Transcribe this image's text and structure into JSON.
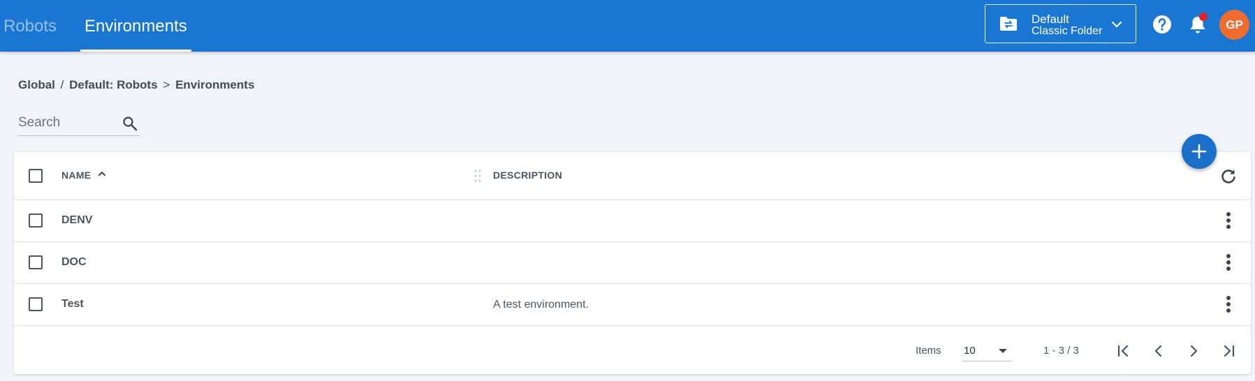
{
  "header": {
    "tabs": [
      {
        "label": "Robots",
        "active": false
      },
      {
        "label": "Environments",
        "active": true
      }
    ],
    "folder": {
      "name": "Default",
      "type": "Classic Folder",
      "icon": "folder-switch-icon"
    },
    "notification_dot_color": "#e0242f",
    "avatar_initials": "GP",
    "avatar_color": "#f06b30",
    "accent_color": "#1976d2"
  },
  "breadcrumb": {
    "root": "Global",
    "separator": "/",
    "folder": "Default: Robots",
    "arrow": ">",
    "current": "Environments"
  },
  "search": {
    "placeholder": "Search",
    "value": ""
  },
  "table": {
    "columns": [
      {
        "label": "NAME",
        "sort": "ascending"
      },
      {
        "label": "DESCRIPTION"
      }
    ],
    "rows": [
      {
        "name": "DENV",
        "description": ""
      },
      {
        "name": "DOC",
        "description": ""
      },
      {
        "name": "Test",
        "description": "A test environment."
      }
    ]
  },
  "pagination": {
    "items_label": "Items",
    "page_size": "10",
    "range": "1 - 3 / 3"
  }
}
